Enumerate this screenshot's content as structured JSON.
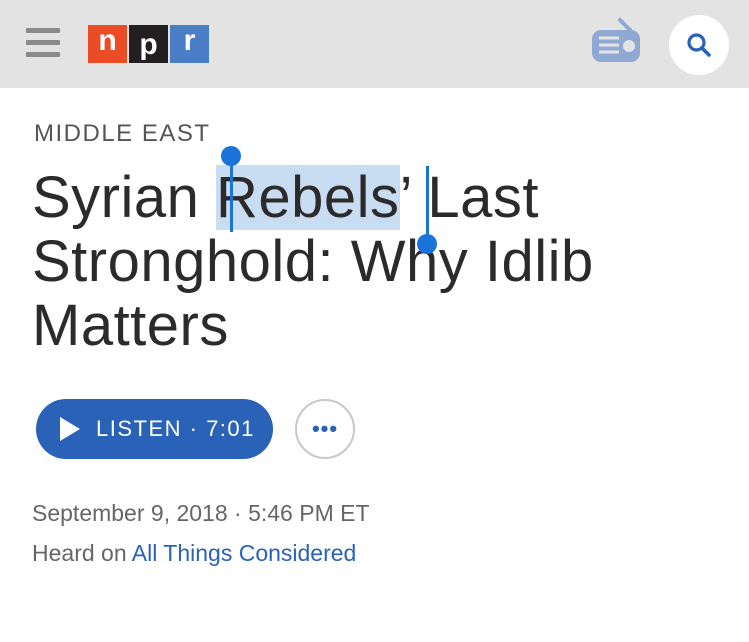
{
  "header": {
    "menu_icon": "hamburger-menu-icon",
    "logo": {
      "n": "n",
      "p": "p",
      "r": "r"
    },
    "radio_icon": "radio-icon",
    "search_icon": "search-icon"
  },
  "article": {
    "section": "MIDDLE EAST",
    "headline": {
      "before_selection": "Syrian ",
      "selected": "Rebels",
      "after_selection": "’ Last Stronghold: Why Idlib Matters"
    },
    "listen": {
      "label": "LISTEN · 7:01",
      "icon": "play-icon"
    },
    "more": {
      "label": "•••",
      "icon": "more-options-icon"
    },
    "date_line": "September 9, 2018 · 5:46 PM ET",
    "heard_prefix": "Heard on ",
    "program": "All Things Considered"
  },
  "colors": {
    "header_bg": "#e3e3e3",
    "npr_red": "#ea4c26",
    "npr_black": "#231f20",
    "npr_blue": "#4a7fc7",
    "accent_blue": "#2a62b8",
    "selection_bg": "#c8dcf2",
    "selection_handle": "#1a73d9"
  }
}
